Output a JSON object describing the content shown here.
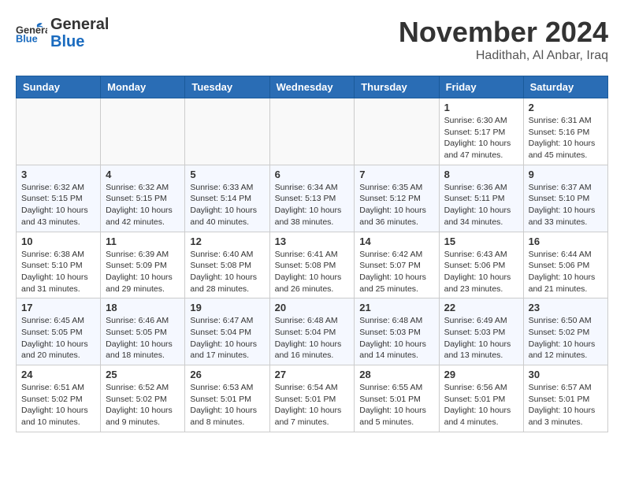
{
  "header": {
    "logo_line1": "General",
    "logo_line2": "Blue",
    "month": "November 2024",
    "location": "Hadithah, Al Anbar, Iraq"
  },
  "weekdays": [
    "Sunday",
    "Monday",
    "Tuesday",
    "Wednesday",
    "Thursday",
    "Friday",
    "Saturday"
  ],
  "weeks": [
    [
      {
        "day": "",
        "info": ""
      },
      {
        "day": "",
        "info": ""
      },
      {
        "day": "",
        "info": ""
      },
      {
        "day": "",
        "info": ""
      },
      {
        "day": "",
        "info": ""
      },
      {
        "day": "1",
        "info": "Sunrise: 6:30 AM\nSunset: 5:17 PM\nDaylight: 10 hours\nand 47 minutes."
      },
      {
        "day": "2",
        "info": "Sunrise: 6:31 AM\nSunset: 5:16 PM\nDaylight: 10 hours\nand 45 minutes."
      }
    ],
    [
      {
        "day": "3",
        "info": "Sunrise: 6:32 AM\nSunset: 5:15 PM\nDaylight: 10 hours\nand 43 minutes."
      },
      {
        "day": "4",
        "info": "Sunrise: 6:32 AM\nSunset: 5:15 PM\nDaylight: 10 hours\nand 42 minutes."
      },
      {
        "day": "5",
        "info": "Sunrise: 6:33 AM\nSunset: 5:14 PM\nDaylight: 10 hours\nand 40 minutes."
      },
      {
        "day": "6",
        "info": "Sunrise: 6:34 AM\nSunset: 5:13 PM\nDaylight: 10 hours\nand 38 minutes."
      },
      {
        "day": "7",
        "info": "Sunrise: 6:35 AM\nSunset: 5:12 PM\nDaylight: 10 hours\nand 36 minutes."
      },
      {
        "day": "8",
        "info": "Sunrise: 6:36 AM\nSunset: 5:11 PM\nDaylight: 10 hours\nand 34 minutes."
      },
      {
        "day": "9",
        "info": "Sunrise: 6:37 AM\nSunset: 5:10 PM\nDaylight: 10 hours\nand 33 minutes."
      }
    ],
    [
      {
        "day": "10",
        "info": "Sunrise: 6:38 AM\nSunset: 5:10 PM\nDaylight: 10 hours\nand 31 minutes."
      },
      {
        "day": "11",
        "info": "Sunrise: 6:39 AM\nSunset: 5:09 PM\nDaylight: 10 hours\nand 29 minutes."
      },
      {
        "day": "12",
        "info": "Sunrise: 6:40 AM\nSunset: 5:08 PM\nDaylight: 10 hours\nand 28 minutes."
      },
      {
        "day": "13",
        "info": "Sunrise: 6:41 AM\nSunset: 5:08 PM\nDaylight: 10 hours\nand 26 minutes."
      },
      {
        "day": "14",
        "info": "Sunrise: 6:42 AM\nSunset: 5:07 PM\nDaylight: 10 hours\nand 25 minutes."
      },
      {
        "day": "15",
        "info": "Sunrise: 6:43 AM\nSunset: 5:06 PM\nDaylight: 10 hours\nand 23 minutes."
      },
      {
        "day": "16",
        "info": "Sunrise: 6:44 AM\nSunset: 5:06 PM\nDaylight: 10 hours\nand 21 minutes."
      }
    ],
    [
      {
        "day": "17",
        "info": "Sunrise: 6:45 AM\nSunset: 5:05 PM\nDaylight: 10 hours\nand 20 minutes."
      },
      {
        "day": "18",
        "info": "Sunrise: 6:46 AM\nSunset: 5:05 PM\nDaylight: 10 hours\nand 18 minutes."
      },
      {
        "day": "19",
        "info": "Sunrise: 6:47 AM\nSunset: 5:04 PM\nDaylight: 10 hours\nand 17 minutes."
      },
      {
        "day": "20",
        "info": "Sunrise: 6:48 AM\nSunset: 5:04 PM\nDaylight: 10 hours\nand 16 minutes."
      },
      {
        "day": "21",
        "info": "Sunrise: 6:48 AM\nSunset: 5:03 PM\nDaylight: 10 hours\nand 14 minutes."
      },
      {
        "day": "22",
        "info": "Sunrise: 6:49 AM\nSunset: 5:03 PM\nDaylight: 10 hours\nand 13 minutes."
      },
      {
        "day": "23",
        "info": "Sunrise: 6:50 AM\nSunset: 5:02 PM\nDaylight: 10 hours\nand 12 minutes."
      }
    ],
    [
      {
        "day": "24",
        "info": "Sunrise: 6:51 AM\nSunset: 5:02 PM\nDaylight: 10 hours\nand 10 minutes."
      },
      {
        "day": "25",
        "info": "Sunrise: 6:52 AM\nSunset: 5:02 PM\nDaylight: 10 hours\nand 9 minutes."
      },
      {
        "day": "26",
        "info": "Sunrise: 6:53 AM\nSunset: 5:01 PM\nDaylight: 10 hours\nand 8 minutes."
      },
      {
        "day": "27",
        "info": "Sunrise: 6:54 AM\nSunset: 5:01 PM\nDaylight: 10 hours\nand 7 minutes."
      },
      {
        "day": "28",
        "info": "Sunrise: 6:55 AM\nSunset: 5:01 PM\nDaylight: 10 hours\nand 5 minutes."
      },
      {
        "day": "29",
        "info": "Sunrise: 6:56 AM\nSunset: 5:01 PM\nDaylight: 10 hours\nand 4 minutes."
      },
      {
        "day": "30",
        "info": "Sunrise: 6:57 AM\nSunset: 5:01 PM\nDaylight: 10 hours\nand 3 minutes."
      }
    ]
  ]
}
